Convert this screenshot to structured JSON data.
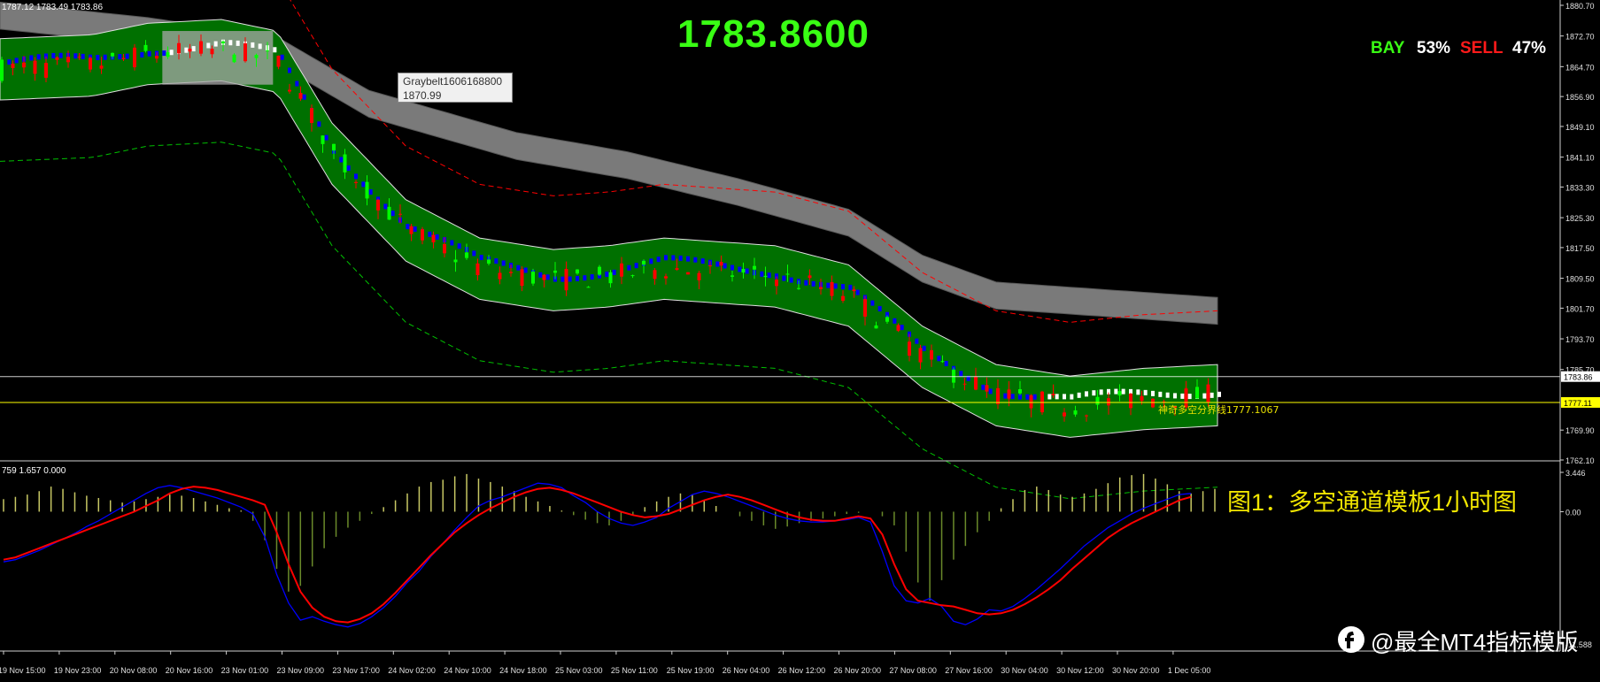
{
  "header": {
    "ohlc_text": "1787.12 1783.49 1783.86",
    "current_price": "1783.8600",
    "bay_label": "BAY",
    "bay_pct": "53%",
    "sell_label": "SELL",
    "sell_pct": "47%"
  },
  "tooltip": {
    "line1": "Graybelt1606168800",
    "line2": "1870.99"
  },
  "annotations": {
    "boundary_label": "神奇多空分界线1777.1067",
    "caption": "图1：多空通道模板1小时图",
    "watermark": "@最全MT4指标模版"
  },
  "oscillator": {
    "info_text": "759 1.657 0.000",
    "axis_labels": [
      "3.446",
      "0.00",
      "-11.588"
    ]
  },
  "colors": {
    "background": "#000000",
    "bull_candle": "#00ff00",
    "bear_candle": "#ff0000",
    "channel_fill": "#007000",
    "gray_belt": "#7a7a7a",
    "dash_upper": "#ff0000",
    "dash_lower": "#00c000",
    "blue_line": "#0000ff",
    "osc_hist": "#c8c864",
    "osc_main": "#ff0000",
    "osc_signal": "#0000ff",
    "boundary_line": "#ffff00",
    "current_line": "#ffffff"
  },
  "chart_data": [
    {
      "type": "candlestick",
      "name": "XAUUSD H1",
      "ylim": [
        1762.1,
        1880.7
      ],
      "y_ticks": [
        "1880.70",
        "1872.70",
        "1864.70",
        "1856.90",
        "1849.10",
        "1841.10",
        "1833.30",
        "1825.30",
        "1817.50",
        "1809.50",
        "1801.70",
        "1793.70",
        "1785.70",
        "1769.90",
        "1762.10"
      ],
      "current_price": 1783.86,
      "boundary_price": 1777.11,
      "x_labels": [
        "19 Nov 15:00",
        "19 Nov 23:00",
        "20 Nov 08:00",
        "20 Nov 16:00",
        "23 Nov 01:00",
        "23 Nov 09:00",
        "23 Nov 17:00",
        "24 Nov 02:00",
        "24 Nov 10:00",
        "24 Nov 18:00",
        "25 Nov 03:00",
        "25 Nov 11:00",
        "25 Nov 19:00",
        "26 Nov 04:00",
        "26 Nov 12:00",
        "26 Nov 20:00",
        "27 Nov 08:00",
        "27 Nov 16:00",
        "30 Nov 04:00",
        "30 Nov 12:00",
        "30 Nov 20:00",
        "1 Dec 05:00"
      ],
      "mid_path": [
        [
          0,
          1864
        ],
        [
          25,
          1865
        ],
        [
          40,
          1868
        ],
        [
          60,
          1869
        ],
        [
          75,
          1866
        ],
        [
          90,
          1842
        ],
        [
          110,
          1822
        ],
        [
          130,
          1812
        ],
        [
          150,
          1809
        ],
        [
          165,
          1810
        ],
        [
          180,
          1812
        ],
        [
          195,
          1811
        ],
        [
          210,
          1810
        ],
        [
          230,
          1805
        ],
        [
          250,
          1789
        ],
        [
          270,
          1779
        ],
        [
          290,
          1776
        ],
        [
          310,
          1778
        ],
        [
          330,
          1779
        ]
      ],
      "half_width": 8,
      "gray_belt_path": [
        [
          0,
          1878
        ],
        [
          40,
          1874
        ],
        [
          75,
          1869
        ],
        [
          100,
          1855
        ],
        [
          140,
          1844
        ],
        [
          170,
          1839
        ],
        [
          200,
          1832
        ],
        [
          230,
          1824
        ],
        [
          250,
          1812
        ],
        [
          270,
          1805
        ],
        [
          330,
          1801
        ]
      ],
      "gray_belt_half_width": 3.5
    },
    {
      "type": "oscillator",
      "name": "MACD-style",
      "ylim": [
        -11.588,
        3.446
      ],
      "hist": [
        1.1,
        1.3,
        1.5,
        1.8,
        2.2,
        2.0,
        1.7,
        1.4,
        1.2,
        1.0,
        0.8,
        0.9,
        1.1,
        1.3,
        1.5,
        1.4,
        1.2,
        0.9,
        0.6,
        0.3,
        0.1,
        -0.8,
        -2.5,
        -5.0,
        -7.0,
        -6.5,
        -4.8,
        -3.2,
        -2.2,
        -1.4,
        -0.8,
        -0.2,
        0.4,
        1.0,
        1.6,
        2.2,
        2.6,
        2.8,
        3.1,
        3.3,
        2.9,
        2.6,
        2.2,
        1.8,
        1.3,
        0.9,
        0.5,
        0.1,
        -0.3,
        -0.7,
        -1.0,
        -1.2,
        -0.8,
        -0.3,
        0.4,
        0.9,
        1.3,
        1.6,
        1.5,
        1.0,
        0.5,
        0.0,
        -0.4,
        -0.8,
        -1.2,
        -1.5,
        -1.3,
        -1.0,
        -0.8,
        -0.6,
        -0.4,
        -0.2,
        -0.1,
        0.0,
        -0.4,
        -1.2,
        -3.5,
        -6.2,
        -7.8,
        -6.0,
        -4.2,
        -3.0,
        -1.8,
        -0.8,
        0.3,
        1.1,
        1.9,
        2.2,
        1.9,
        1.5,
        1.3,
        1.6,
        2.0,
        2.5,
        3.0,
        3.2,
        3.3,
        2.9,
        2.4,
        1.8,
        1.6,
        1.8,
        2.0
      ],
      "main_line": [
        -4.2,
        -4.0,
        -3.6,
        -3.2,
        -2.8,
        -2.4,
        -2.0,
        -1.6,
        -1.2,
        -0.8,
        -0.4,
        0.0,
        0.5,
        1.0,
        1.6,
        2.0,
        2.2,
        2.1,
        1.9,
        1.6,
        1.3,
        1.0,
        0.6,
        -1.8,
        -4.6,
        -7.0,
        -8.4,
        -9.2,
        -9.6,
        -9.7,
        -9.4,
        -8.9,
        -8.1,
        -7.1,
        -6.0,
        -4.9,
        -3.8,
        -2.8,
        -1.8,
        -1.0,
        -0.3,
        0.3,
        0.8,
        1.3,
        1.7,
        2.0,
        2.1,
        1.9,
        1.6,
        1.2,
        0.8,
        0.4,
        0.0,
        -0.3,
        -0.5,
        -0.4,
        -0.2,
        0.2,
        0.6,
        1.0,
        1.3,
        1.5,
        1.3,
        1.0,
        0.6,
        0.2,
        -0.2,
        -0.5,
        -0.7,
        -0.8,
        -0.8,
        -0.6,
        -0.4,
        -0.6,
        -2.0,
        -4.6,
        -6.8,
        -7.8,
        -8.0,
        -8.2,
        -8.3,
        -8.6,
        -8.9,
        -9.0,
        -8.9,
        -8.6,
        -8.1,
        -7.5,
        -6.8,
        -6.0,
        -5.0,
        -4.1,
        -3.2,
        -2.3,
        -1.6,
        -1.0,
        -0.5,
        0.0,
        0.5,
        1.0,
        1.3
      ],
      "signal_line": [
        -4.4,
        -4.2,
        -3.8,
        -3.4,
        -2.9,
        -2.4,
        -1.9,
        -1.3,
        -0.8,
        -0.2,
        0.4,
        1.0,
        1.6,
        2.1,
        2.3,
        2.1,
        1.8,
        1.5,
        1.2,
        0.8,
        0.4,
        -0.2,
        -2.2,
        -5.5,
        -8.0,
        -9.5,
        -9.2,
        -9.6,
        -9.9,
        -10.1,
        -9.8,
        -9.2,
        -8.4,
        -7.4,
        -6.2,
        -5.2,
        -3.9,
        -2.8,
        -1.6,
        -0.5,
        0.5,
        1.0,
        1.3,
        1.7,
        2.1,
        2.5,
        2.4,
        2.1,
        1.4,
        0.8,
        0.0,
        -0.6,
        -1.0,
        -1.2,
        -0.9,
        -0.5,
        0.3,
        0.9,
        1.5,
        1.8,
        1.6,
        1.3,
        0.9,
        0.5,
        0.1,
        -0.3,
        -0.6,
        -0.8,
        -0.9,
        -0.9,
        -0.8,
        -0.7,
        -0.5,
        -0.9,
        -3.5,
        -6.5,
        -7.8,
        -8.0,
        -7.6,
        -8.3,
        -9.6,
        -9.9,
        -9.4,
        -8.6,
        -8.7,
        -8.3,
        -7.6,
        -6.8,
        -5.9,
        -5.0,
        -4.0,
        -3.0,
        -2.2,
        -1.4,
        -0.8,
        -0.2,
        0.3,
        0.7,
        1.1,
        1.5,
        1.6
      ]
    }
  ]
}
